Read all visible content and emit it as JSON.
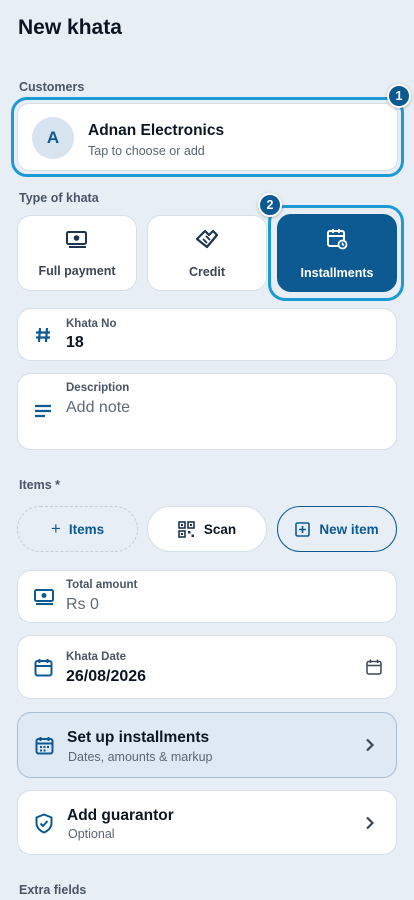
{
  "page": {
    "title": "New khata"
  },
  "customers": {
    "label": "Customers",
    "avatar_letter": "A",
    "name": "Adnan Electronics",
    "subtitle": "Tap to choose or add",
    "step": "1"
  },
  "khata_type": {
    "label": "Type of khata",
    "step": "2",
    "options": [
      {
        "label": "Full payment",
        "icon": "cash-icon",
        "selected": false
      },
      {
        "label": "Credit",
        "icon": "handshake-icon",
        "selected": false
      },
      {
        "label": "Installments",
        "icon": "calendar-refresh-icon",
        "selected": true
      }
    ]
  },
  "khata_no": {
    "label": "Khata No",
    "value": "18",
    "icon": "hash-icon"
  },
  "description": {
    "label": "Description",
    "placeholder": "Add note",
    "icon": "notes-icon"
  },
  "items": {
    "label": "Items *",
    "add_label": "Items",
    "scan_label": "Scan",
    "new_label": "New item"
  },
  "total_amount": {
    "label": "Total amount",
    "value": "Rs 0",
    "icon": "cash-icon"
  },
  "khata_date": {
    "label": "Khata Date",
    "value": "26/08/2026",
    "icon": "calendar-icon"
  },
  "installments": {
    "title": "Set up installments",
    "subtitle": "Dates, amounts & markup",
    "icon": "calendar-grid-icon"
  },
  "guarantor": {
    "title": "Add guarantor",
    "subtitle": "Optional",
    "icon": "shield-check-icon"
  },
  "extra_fields": {
    "label": "Extra fields"
  },
  "colors": {
    "primary": "#0d5a93",
    "highlight": "#1d9ad6",
    "background": "#e7eef5",
    "card": "#ffffff"
  }
}
